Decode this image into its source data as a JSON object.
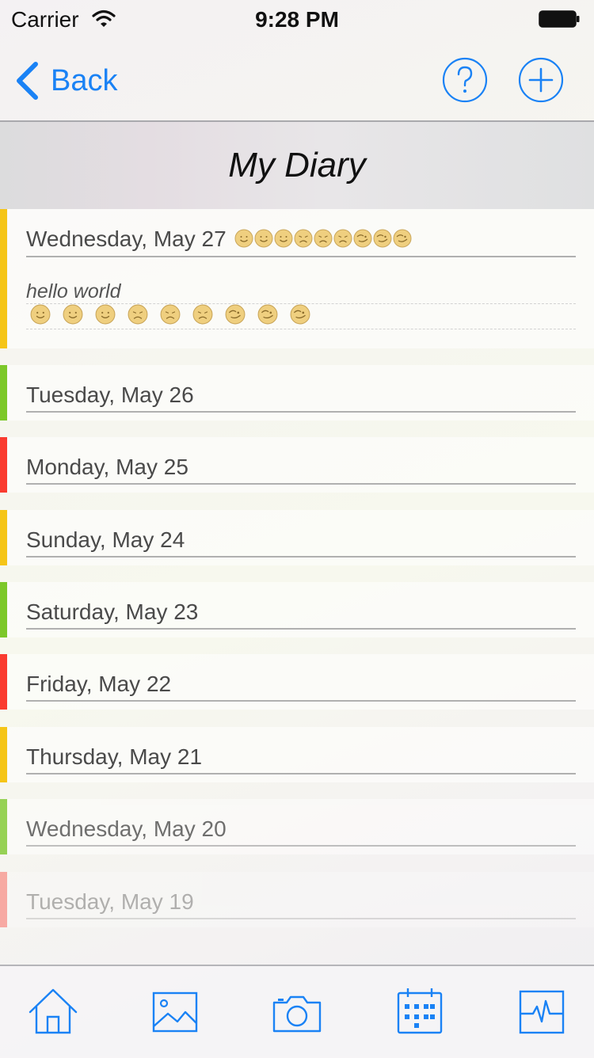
{
  "status_bar": {
    "carrier": "Carrier",
    "time": "9:28 PM"
  },
  "nav": {
    "back_label": "Back",
    "help_icon": "question-circle-icon",
    "add_icon": "plus-circle-icon"
  },
  "title": "My Diary",
  "colors": {
    "accent": "#1a82f5",
    "yellow": "#f5c518",
    "green": "#7cc82a",
    "red": "#fa3b30",
    "mood_face": "#efcf7f"
  },
  "entries": [
    {
      "date": "Wednesday, May 27",
      "color": "yellow",
      "note": "hello world",
      "moods": [
        "smile",
        "smile",
        "smile",
        "frown",
        "frown",
        "frown",
        "wink",
        "wink",
        "wink"
      ]
    },
    {
      "date": "Tuesday, May 26",
      "color": "green"
    },
    {
      "date": "Monday, May 25",
      "color": "red"
    },
    {
      "date": "Sunday, May 24",
      "color": "yellow"
    },
    {
      "date": "Saturday, May 23",
      "color": "green"
    },
    {
      "date": "Friday, May 22",
      "color": "red"
    },
    {
      "date": "Thursday, May 21",
      "color": "yellow"
    },
    {
      "date": "Wednesday, May 20",
      "color": "green"
    },
    {
      "date": "Tuesday, May 19",
      "color": "red"
    }
  ],
  "tab_bar": [
    "home-icon",
    "picture-icon",
    "camera-icon",
    "calendar-icon",
    "pulse-icon"
  ]
}
